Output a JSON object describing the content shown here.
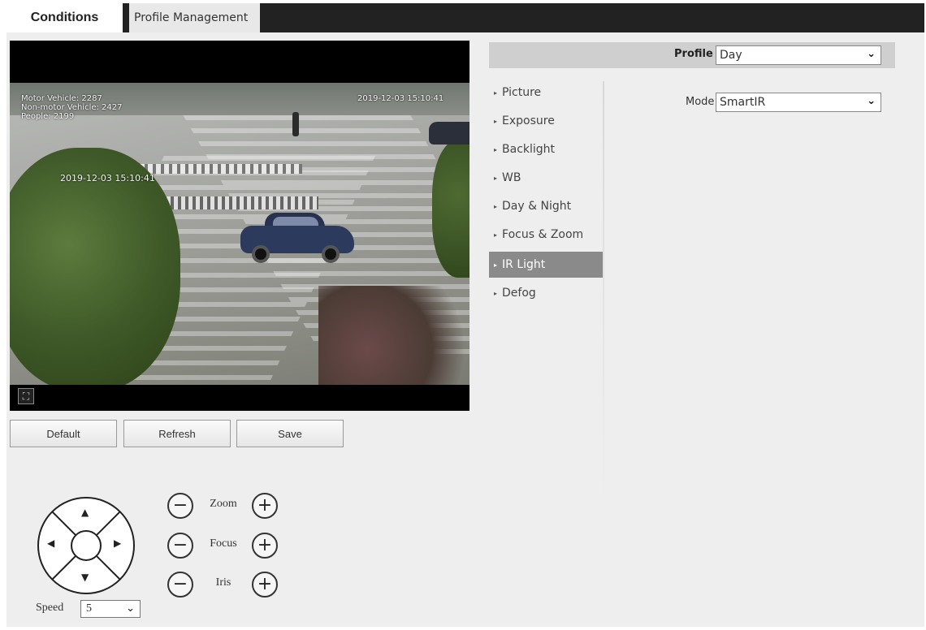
{
  "tabs": {
    "conditions": "Conditions",
    "profile_management": "Profile Management"
  },
  "video": {
    "osd_counts": [
      "Motor Vehicle: 2287",
      "Non-motor Vehicle: 2427",
      "People: 2199"
    ],
    "osd_timestamp": "2019-12-03 15:10:41",
    "osd_mid": "2019-12-03 15:10:41"
  },
  "actions": {
    "default": "Default",
    "refresh": "Refresh",
    "save": "Save"
  },
  "ptz": {
    "speed_label": "Speed",
    "speed_value": "5",
    "zoom_label": "Zoom",
    "focus_label": "Focus",
    "iris_label": "Iris",
    "minus": "−",
    "plus": "+"
  },
  "profile": {
    "label": "Profile",
    "value": "Day"
  },
  "menu": [
    {
      "label": "Picture",
      "active": false
    },
    {
      "label": "Exposure",
      "active": false
    },
    {
      "label": "Backlight",
      "active": false
    },
    {
      "label": "WB",
      "active": false
    },
    {
      "label": "Day & Night",
      "active": false
    },
    {
      "label": "Focus & Zoom",
      "active": false
    },
    {
      "label": "IR Light",
      "active": true
    },
    {
      "label": "Defog",
      "active": false
    }
  ],
  "ir_light": {
    "mode_label": "Mode",
    "mode_value": "SmartIR"
  },
  "icons": {
    "triangle": "▸",
    "chevron": "⌄",
    "fullscreen": "⛶"
  }
}
